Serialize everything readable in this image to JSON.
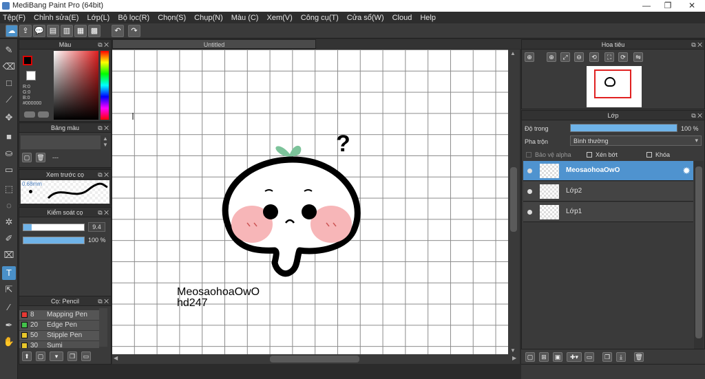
{
  "window": {
    "title": "MediBang Paint Pro (64bit)",
    "min": "—",
    "restore": "❐",
    "close": "✕"
  },
  "menu": [
    "Tệp(F)",
    "Chỉnh sửa(E)",
    "Lớp(L)",
    "Bộ lọc(R)",
    "Chọn(S)",
    "Chụp(N)",
    "Màu (C)",
    "Xem(V)",
    "Công cụ(T)",
    "Cửa sổ(W)",
    "Cloud",
    "Help"
  ],
  "toolbar": {
    "undo": "↶",
    "redo": "↷"
  },
  "color_panel": {
    "title": "Màu",
    "r": "R:0",
    "g": "G:0",
    "b": "B:0",
    "hex": "#000000",
    "fg": "#000000",
    "bg": "#ffffff"
  },
  "palette_panel": {
    "title": "Bảng màu",
    "value": "---"
  },
  "brush_preview": {
    "title": "Xem trước cọ",
    "size": "0.68mm"
  },
  "brush_control": {
    "title": "Kiểm soát cọ",
    "size_value": "9.4",
    "opacity_value": "100 %",
    "size_fraction": 0.14,
    "opacity_fraction": 1.0
  },
  "brush_list": {
    "title": "Cọ: Pencil",
    "items": [
      {
        "color": "#e53935",
        "size": "8",
        "name": "Mapping Pen"
      },
      {
        "color": "#43c24a",
        "size": "20",
        "name": "Edge Pen"
      },
      {
        "color": "#e8c72c",
        "size": "50",
        "name": "Stipple Pen"
      },
      {
        "color": "#e8c72c",
        "size": "30",
        "name": "Sumi"
      }
    ]
  },
  "document": {
    "tab": "Untitled",
    "caption_line1": "MeosaohoaOwO",
    "caption_line2": "hd247",
    "question_mark": "?"
  },
  "navigator": {
    "title": "Hoa tiêu"
  },
  "layers_panel": {
    "title": "Lớp",
    "opacity_label": "Độ trong",
    "opacity_value": "100 %",
    "opacity_fraction": 1.0,
    "blend_label": "Pha trộn",
    "blend_value": "Bình thường",
    "protect_alpha": "Bảo vệ alpha",
    "clipping": "Xén bớt",
    "lock": "Khóa",
    "layers": [
      {
        "name": "MeosaohoaOwO",
        "selected": true
      },
      {
        "name": "Lớp2",
        "selected": false
      },
      {
        "name": "Lớp1",
        "selected": false
      }
    ]
  }
}
